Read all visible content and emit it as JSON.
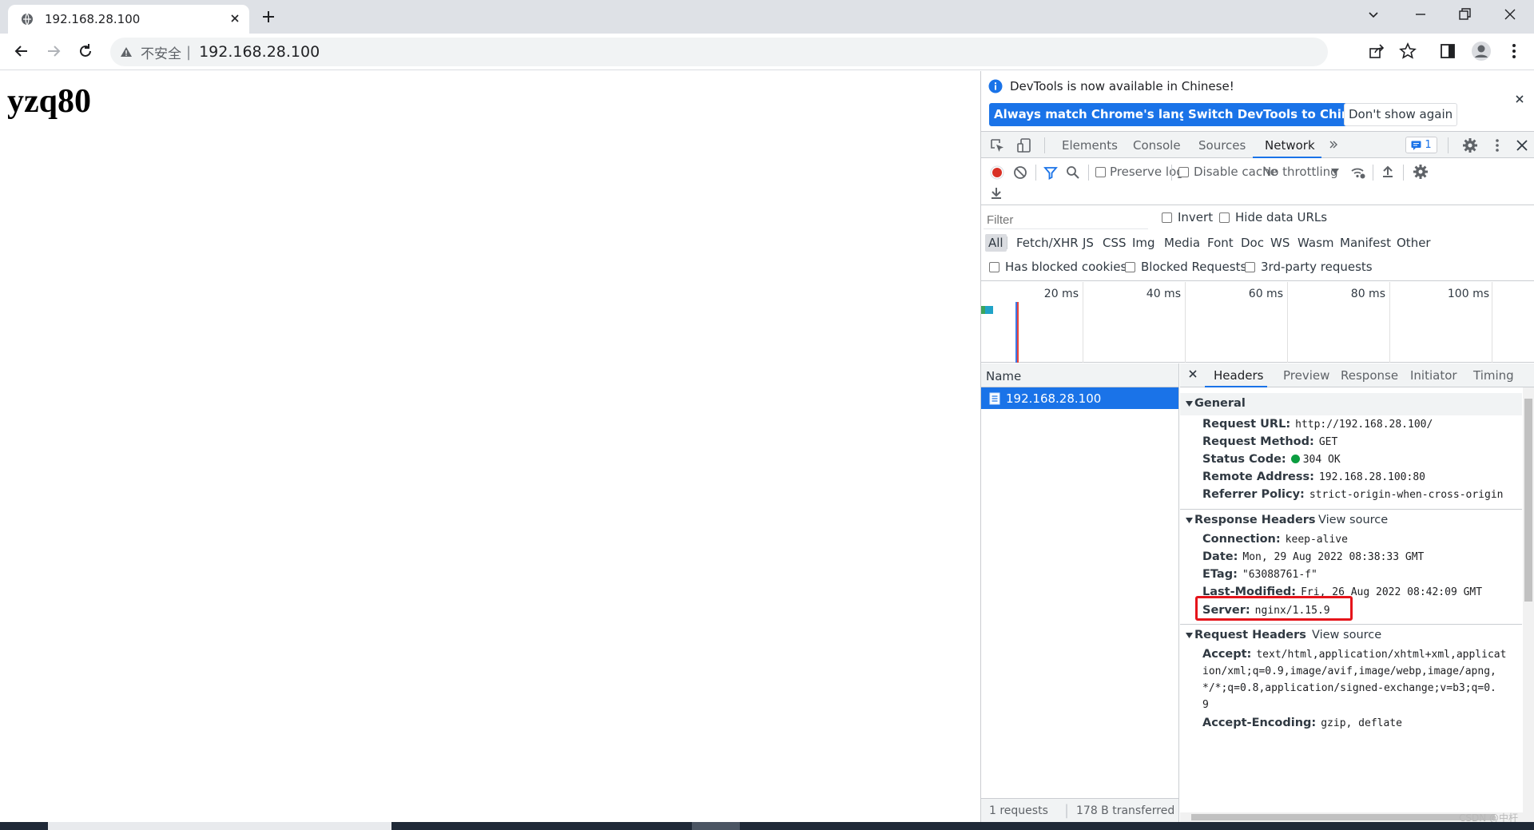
{
  "browser": {
    "tab_title": "192.168.28.100",
    "insecure_label": "不安全",
    "separator": "|",
    "url": "192.168.28.100"
  },
  "page": {
    "heading": "yzq80"
  },
  "devtools": {
    "infobar": {
      "message": "DevTools is now available in Chinese!",
      "btn_match": "Always match Chrome's language",
      "btn_switch": "Switch DevTools to Chinese",
      "btn_dont_show": "Don't show again"
    },
    "tabs": [
      "Elements",
      "Console",
      "Sources",
      "Network"
    ],
    "active_tab": "Network",
    "message_count": "1",
    "network_toolbar": {
      "preserve_log": "Preserve log",
      "disable_cache": "Disable cache",
      "throttling": "No throttling"
    },
    "filter": {
      "placeholder": "Filter",
      "invert": "Invert",
      "hide_data_urls": "Hide data URLs",
      "types": [
        "All",
        "Fetch/XHR",
        "JS",
        "CSS",
        "Img",
        "Media",
        "Font",
        "Doc",
        "WS",
        "Wasm",
        "Manifest",
        "Other"
      ],
      "has_blocked_cookies": "Has blocked cookies",
      "blocked_requests": "Blocked Requests",
      "third_party": "3rd-party requests"
    },
    "overview_ticks": [
      "20 ms",
      "40 ms",
      "60 ms",
      "80 ms",
      "100 ms"
    ],
    "requests": {
      "name_header": "Name",
      "items": [
        "192.168.28.100"
      ],
      "summary_count": "1 requests",
      "summary_transferred": "178 B transferred"
    },
    "detail_tabs": [
      "Headers",
      "Preview",
      "Response",
      "Initiator",
      "Timing"
    ],
    "general": {
      "title": "General",
      "rows": [
        {
          "k": "Request URL:",
          "v": "http://192.168.28.100/"
        },
        {
          "k": "Request Method:",
          "v": "GET"
        },
        {
          "k": "Status Code:",
          "v": "304 OK"
        },
        {
          "k": "Remote Address:",
          "v": "192.168.28.100:80"
        },
        {
          "k": "Referrer Policy:",
          "v": "strict-origin-when-cross-origin"
        }
      ]
    },
    "response_headers": {
      "title": "Response Headers",
      "view_source": "View source",
      "rows": [
        {
          "k": "Connection:",
          "v": "keep-alive"
        },
        {
          "k": "Date:",
          "v": "Mon, 29 Aug 2022 08:38:33 GMT"
        },
        {
          "k": "ETag:",
          "v": "\"63088761-f\""
        },
        {
          "k": "Last-Modified:",
          "v": "Fri, 26 Aug 2022 08:42:09 GMT"
        },
        {
          "k": "Server:",
          "v": "nginx/1.15.9"
        }
      ]
    },
    "request_headers": {
      "title": "Request Headers",
      "view_source": "View source",
      "accept_key": "Accept:",
      "accept_lines": [
        "text/html,application/xhtml+xml,applicat",
        "ion/xml;q=0.9,image/avif,image/webp,image/apng,",
        "*/*;q=0.8,application/signed-exchange;v=b3;q=0.",
        "9"
      ],
      "encoding_key": "Accept-Encoding:",
      "encoding_value": "gzip, deflate"
    }
  },
  "watermark": "CSDN @中杆",
  "colors": {
    "accent": "#1a73e8",
    "highlight": "#e5141b",
    "status_ok": "#0b9d40"
  }
}
